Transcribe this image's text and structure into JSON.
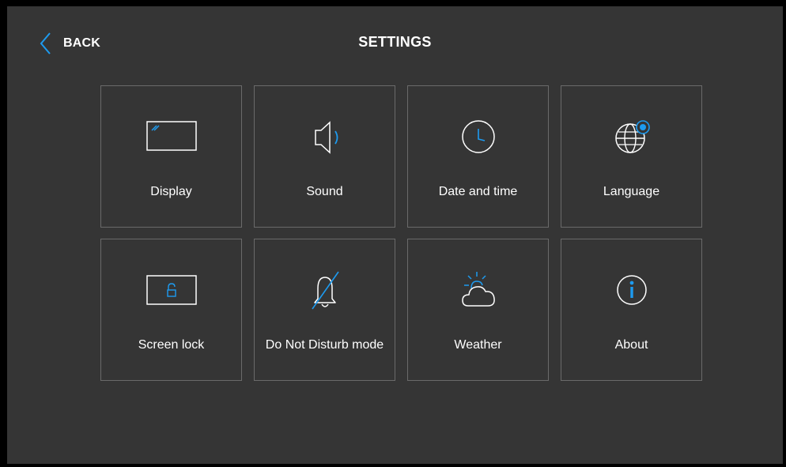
{
  "colors": {
    "background": "#353535",
    "accent": "#1d9bf0",
    "text": "#ffffff",
    "tile_border": "#6a6a6a"
  },
  "header": {
    "back_icon": "chevron-left-icon",
    "back_label": "BACK",
    "title": "SETTINGS"
  },
  "tiles": [
    {
      "label": "Display",
      "icon": "display-icon"
    },
    {
      "label": "Sound",
      "icon": "speaker-icon"
    },
    {
      "label": "Date and time",
      "icon": "clock-icon"
    },
    {
      "label": "Language",
      "icon": "globe-icon"
    },
    {
      "label": "Screen lock",
      "icon": "screen-lock-icon"
    },
    {
      "label": "Do Not Disturb mode",
      "icon": "bell-muted-icon"
    },
    {
      "label": "Weather",
      "icon": "weather-icon"
    },
    {
      "label": "About",
      "icon": "info-icon"
    }
  ]
}
